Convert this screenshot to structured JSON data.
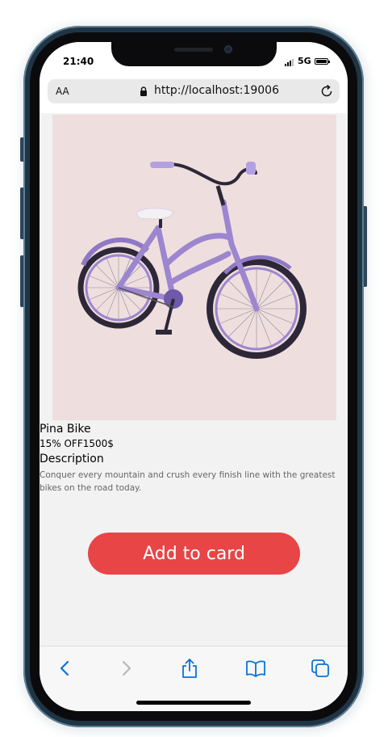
{
  "status_bar": {
    "time": "21:40",
    "network": "5G"
  },
  "browser": {
    "text_size_label": "AA",
    "url": "http://localhost:19006"
  },
  "product": {
    "name": "Pina Bike",
    "price_line": "15% OFF1500$",
    "description_heading": "Description",
    "description": "Conquer every mountain and crush every finish line with the greatest bikes on the road today.",
    "image_alt": "purple bicycle"
  },
  "actions": {
    "add_to_cart_label": "Add to card"
  },
  "toolbar": {
    "icons": [
      "chevron-left-icon",
      "chevron-right-icon",
      "share-icon",
      "bookmarks-icon",
      "tabs-icon"
    ]
  },
  "colors": {
    "accent_button": "#e84547",
    "image_background": "#efdede",
    "ios_blue": "#0a72d8",
    "bike_frame": "#9c86cf"
  }
}
